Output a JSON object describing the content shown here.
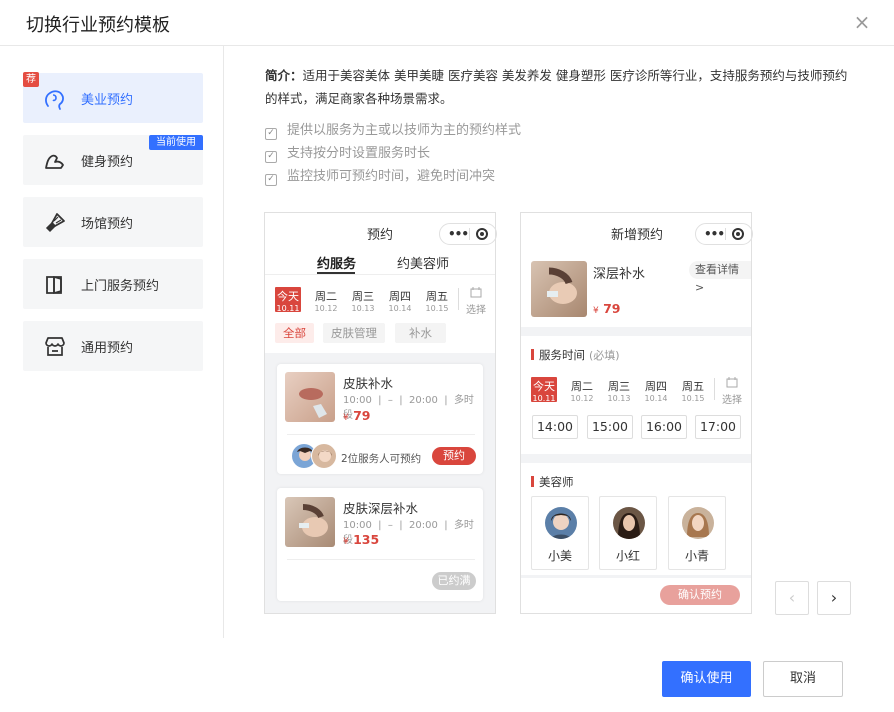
{
  "dialog": {
    "title": "切换行业预约模板",
    "close": "×"
  },
  "sidebar": {
    "items": [
      {
        "label": "美业预约",
        "icon": "beauty-icon"
      },
      {
        "label": "健身预约",
        "icon": "fitness-icon"
      },
      {
        "label": "场馆预约",
        "icon": "badminton-icon"
      },
      {
        "label": "上门服务预约",
        "icon": "door-icon"
      },
      {
        "label": "通用预约",
        "icon": "store-icon"
      }
    ],
    "recommend_badge": "荐",
    "current_badge": "当前使用"
  },
  "intro": {
    "label": "简介：",
    "text": "适用于美容美体 美甲美睫 医疗美容 美发养发 健身塑形 医疗诊所等行业，支持服务预约与技师预约的样式，满足商家各种场景需求。"
  },
  "features": [
    "提供以服务为主或以技师为主的预约样式",
    "支持按分时设置服务时长",
    "监控技师可预约时间，避免时间冲突"
  ],
  "phone1": {
    "title": "预约",
    "tabs": [
      "约服务",
      "约美容师"
    ],
    "days": [
      {
        "w": "今天",
        "d": "10.11"
      },
      {
        "w": "周二",
        "d": "10.12"
      },
      {
        "w": "周三",
        "d": "10.13"
      },
      {
        "w": "周四",
        "d": "10.14"
      },
      {
        "w": "周五",
        "d": "10.15"
      }
    ],
    "select": "选择",
    "chips": [
      "全部",
      "皮肤管理",
      "补水"
    ],
    "cards": [
      {
        "name": "皮肤补水",
        "start": "10:00",
        "dash": "–",
        "end": "20:00",
        "mode": "多时段",
        "currency": "¥",
        "price": "79",
        "staff": "2位服务人可预约",
        "btn": "预约"
      },
      {
        "name": "皮肤深层补水",
        "start": "10:00",
        "dash": "–",
        "end": "20:00",
        "mode": "多时段",
        "currency": "¥",
        "price": "135",
        "btn": "已约满"
      }
    ]
  },
  "phone2": {
    "title": "新增预约",
    "service": {
      "name": "深层补水",
      "detail": "查看详情>",
      "currency": "¥",
      "price": "79"
    },
    "time_title": "服务时间",
    "time_hint": "(必填)",
    "days": [
      {
        "w": "今天",
        "d": "10.11"
      },
      {
        "w": "周二",
        "d": "10.12"
      },
      {
        "w": "周三",
        "d": "10.13"
      },
      {
        "w": "周四",
        "d": "10.14"
      },
      {
        "w": "周五",
        "d": "10.15"
      }
    ],
    "select": "选择",
    "slots": [
      "14:00",
      "15:00",
      "16:00",
      "17:00"
    ],
    "staff_title": "美容师",
    "staff": [
      "小美",
      "小红",
      "小青"
    ],
    "confirm": "确认预约"
  },
  "pager": {
    "prev": "‹",
    "next": "›"
  },
  "footer": {
    "ok": "确认使用",
    "cancel": "取消"
  },
  "colors": {
    "primary": "#3370ff",
    "accent": "#d9463d"
  }
}
